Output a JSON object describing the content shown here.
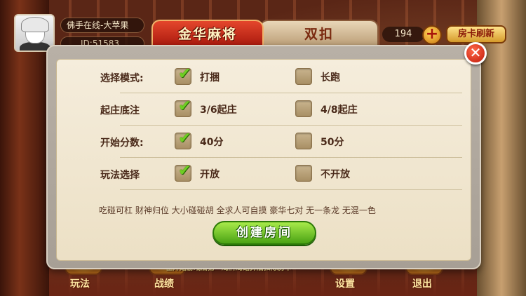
{
  "header": {
    "user_name": "佛手在线-大苹果",
    "user_id": "ID:51583",
    "room_card_count": "194",
    "refresh_label": "房卡刷新",
    "plus_label": "+"
  },
  "tabs": [
    {
      "label": "金华麻将",
      "active": true
    },
    {
      "label": "双扣",
      "active": false
    }
  ],
  "dialog": {
    "close_label": "✕",
    "rows": [
      {
        "label": "选择模式:",
        "option_a": "打捆",
        "option_a_checked": true,
        "option_b": "长跑",
        "option_b_checked": false
      },
      {
        "label": "起庄底注",
        "option_a": "3/6起庄",
        "option_a_checked": true,
        "option_b": "4/8起庄",
        "option_b_checked": false
      },
      {
        "label": "开始分数:",
        "option_a": "40分",
        "option_a_checked": true,
        "option_b": "50分",
        "option_b_checked": false
      },
      {
        "label": "玩法选择",
        "option_a": "开放",
        "option_a_checked": true,
        "option_b": "不开放",
        "option_b_checked": false
      }
    ],
    "rules_text": "吃碰可杠 财神归位 大小碰碰胡 全求人可自摸 豪华七对 无一条龙 无混一色",
    "create_button": "创建房间"
  },
  "notice": "在开始游戏后第一局牌局结算后扣除房卡",
  "bottom_nav": [
    {
      "label": "玩法",
      "icon": "question-icon"
    },
    {
      "label": "战绩",
      "icon": "record-icon"
    },
    {
      "label": "设置",
      "icon": "settings-icon"
    },
    {
      "label": "退出",
      "icon": "exit-icon"
    }
  ],
  "colors": {
    "accent_red": "#c8230e",
    "check_green": "#6fcf22",
    "panel_cream": "#f5eddc",
    "button_green": "#4aa214"
  }
}
